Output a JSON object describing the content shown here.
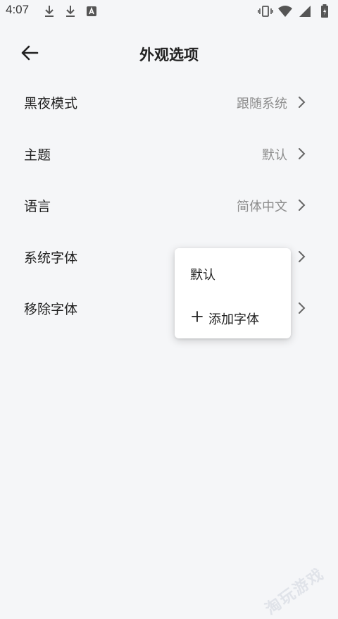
{
  "status_bar": {
    "time": "4:07",
    "left_icons": [
      "download-icon",
      "download-icon",
      "font-app-icon"
    ],
    "right_icons": [
      "vibrate-icon",
      "wifi-icon",
      "signal-icon",
      "battery-charging-icon"
    ]
  },
  "app_bar": {
    "back_icon": "arrow-back-icon",
    "title": "外观选项"
  },
  "settings": {
    "dark_mode": {
      "label": "黑夜模式",
      "value": "跟随系统"
    },
    "theme": {
      "label": "主题",
      "value": "默认"
    },
    "language": {
      "label": "语言",
      "value": "简体中文"
    },
    "system_font": {
      "label": "系统字体"
    },
    "remove_font": {
      "label": "移除字体"
    }
  },
  "popup_menu": {
    "items": [
      {
        "label": "默认"
      },
      {
        "label": "添加字体",
        "icon": "plus-icon"
      }
    ]
  },
  "watermark": {
    "text": "淘玩游戏"
  },
  "colors": {
    "background": "#f5f6f8",
    "text_primary": "#222222",
    "text_secondary": "#8c8c8c",
    "menu_background": "#ffffff"
  }
}
